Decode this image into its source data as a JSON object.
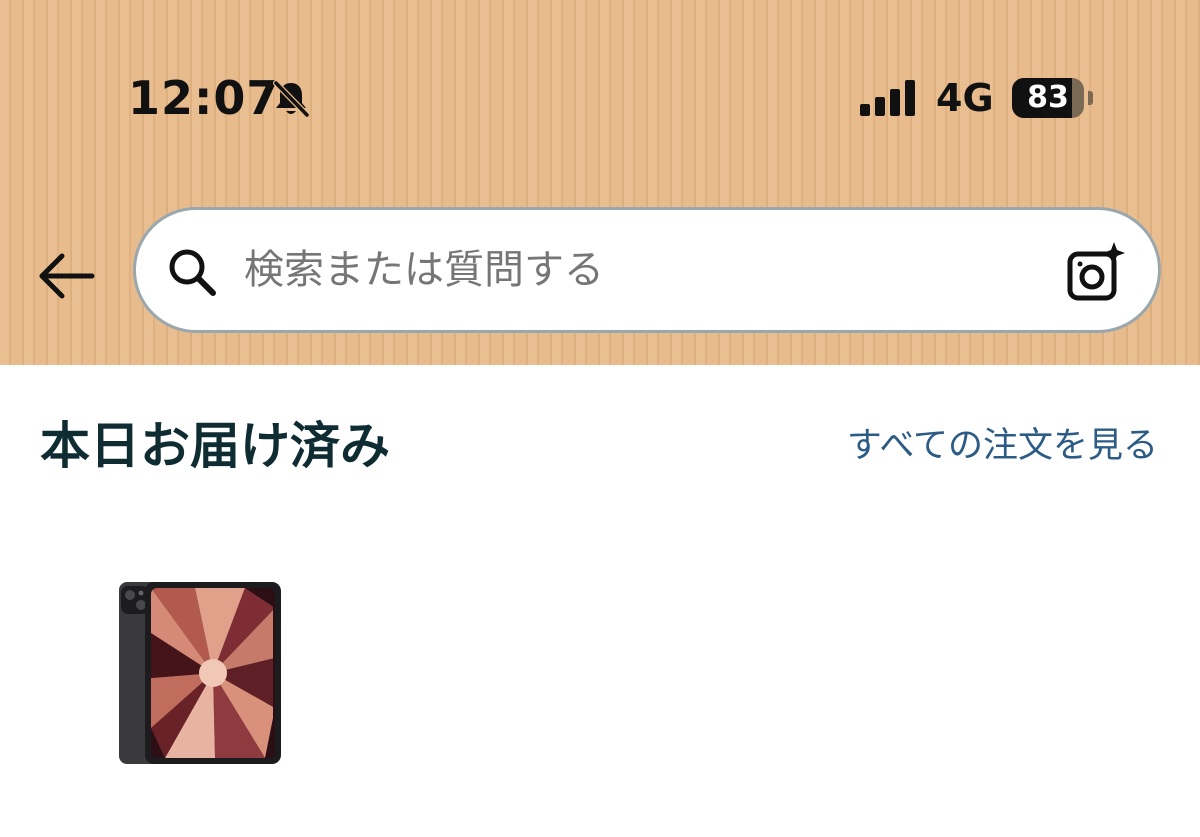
{
  "status_bar": {
    "time": "12:07",
    "network": "4G",
    "battery_percent": "83",
    "battery_level": 0.83,
    "icons": [
      "bell-off-icon",
      "signal-icon",
      "battery-icon"
    ]
  },
  "search": {
    "placeholder": "検索または質問する",
    "value": "",
    "icons": [
      "search-icon",
      "camera-icon"
    ]
  },
  "nav": {
    "back_icon": "back-arrow-icon"
  },
  "section": {
    "title": "本日お届け済み",
    "view_all_link": "すべての注文を見る"
  },
  "products": [
    {
      "image": "tablet-product-image"
    }
  ],
  "colors": {
    "header": "#e6b98a",
    "title": "#0f2c33",
    "link": "#2c5b85",
    "search_border": "#9aa7ad"
  }
}
